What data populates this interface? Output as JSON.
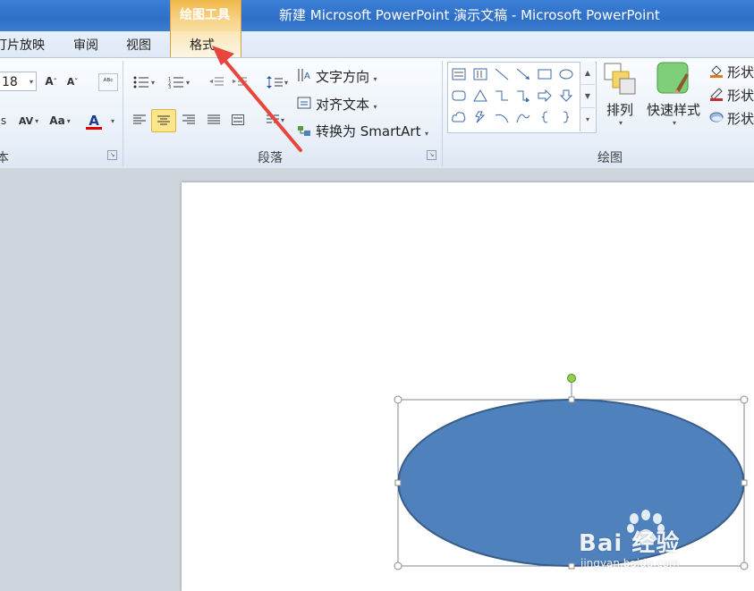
{
  "window": {
    "contextual_tab_group": "绘图工具",
    "title": "新建 Microsoft PowerPoint 演示文稿  -  Microsoft PowerPoint"
  },
  "tabs": [
    {
      "label": "灯片放映"
    },
    {
      "label": "审阅"
    },
    {
      "label": "视图"
    },
    {
      "label": "格式",
      "active": true
    }
  ],
  "ribbon": {
    "font_group": {
      "label": "本",
      "font_size": "18"
    },
    "paragraph_group": {
      "label": "段落",
      "text_direction": "文字方向",
      "align_text": "对齐文本",
      "convert_smartart": "转换为 SmartArt"
    },
    "drawing_group": {
      "label": "绘图",
      "arrange": "排列",
      "quick_styles": "快速样式",
      "shape_fill": "形状",
      "shape_outline": "形状",
      "shape_effects": "形状"
    }
  },
  "slide": {
    "shape": "ellipse",
    "fill_color": "#4f81bd",
    "outline_color": "#385d8a",
    "selected": true
  },
  "annotation": {
    "arrow_color": "#e8453c"
  },
  "watermark": {
    "text": "Bai 经验",
    "url_text": "jingyan.baidu.com"
  },
  "colors": {
    "titlebar": "#2f6fc7",
    "contextual_tab": "#f2b84a",
    "ribbon": "#e9f0f9"
  }
}
